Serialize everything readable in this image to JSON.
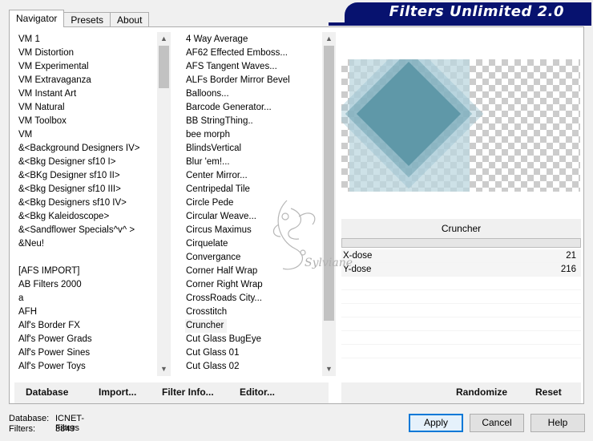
{
  "tabs": [
    "Navigator",
    "Presets",
    "About"
  ],
  "banner_title": "Filters Unlimited 2.0",
  "categories": [
    "VM 1",
    "VM Distortion",
    "VM Experimental",
    "VM Extravaganza",
    "VM Instant Art",
    "VM Natural",
    "VM Toolbox",
    "VM",
    "&<Background Designers IV>",
    "&<Bkg Designer sf10 I>",
    "&<BKg Designer sf10 II>",
    "&<Bkg Designer sf10 III>",
    "&<Bkg Designers sf10 IV>",
    "&<Bkg Kaleidoscope>",
    "&<Sandflower Specials^v^ >",
    "&Neu!",
    "",
    "[AFS IMPORT]",
    "AB Filters 2000",
    "a",
    "AFH",
    "Alf's Border FX",
    "Alf's Power Grads",
    "Alf's Power Sines",
    "Alf's Power Toys"
  ],
  "filters": [
    "4 Way Average",
    "AF62 Effected Emboss...",
    "AFS Tangent Waves...",
    "ALFs Border Mirror Bevel",
    "Balloons...",
    "Barcode Generator...",
    "BB StringThing..",
    "bee morph",
    "BlindsVertical",
    "Blur 'em!...",
    "Center Mirror...",
    "Centripedal Tile",
    "Circle Pede",
    "Circular Weave...",
    "Circus Maximus",
    "Cirquelate",
    "Convergance",
    "Corner Half Wrap",
    "Corner Right Wrap",
    "CrossRoads City...",
    "Crosstitch",
    "Cruncher",
    "Cut Glass  BugEye",
    "Cut Glass 01",
    "Cut Glass 02"
  ],
  "selected_filter": "Cruncher",
  "params": [
    {
      "name": "X-dose",
      "value": "21"
    },
    {
      "name": "Y-dose",
      "value": "216"
    }
  ],
  "bottom_left_buttons": [
    "Database",
    "Import...",
    "Filter Info...",
    "Editor..."
  ],
  "bottom_right_buttons": [
    "Randomize",
    "Reset"
  ],
  "database_label": "Database:",
  "database_value": "ICNET-Filters",
  "filters_label": "Filters:",
  "filters_count": "3849",
  "dialog_buttons": {
    "apply": "Apply",
    "cancel": "Cancel",
    "help": "Help"
  },
  "watermark_text": "Sylviane",
  "colors": {
    "banner": "#07126f",
    "preview_fill": "#5f98a8",
    "default_button_border": "#0078d7"
  }
}
